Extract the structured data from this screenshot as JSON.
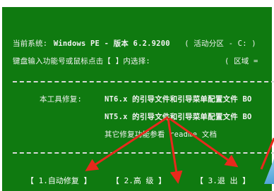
{
  "system_line": {
    "label": "当前系统:",
    "os": "Windows PE - 版本 6.2.9200",
    "partition": "( 活动分区 - C: )"
  },
  "prompt_line": {
    "text": "键盘输入功能号或鼠标点击【 】内选择:",
    "region": "( 区域 ="
  },
  "repair_section": {
    "title": "本工具修复:",
    "nt6": "NT6.x 的引导文件和引导菜单配置文件 BO",
    "nt5": "NT5.x 的引导文件和引导菜单配置文件 BO",
    "other": "其它修复功能参看 readme 文档"
  },
  "menu": {
    "auto_repair": "【 1.自动修复 】",
    "advanced": "【 2.高  级 】",
    "exit": "【 3.退  出 】"
  },
  "colors": {
    "background": "#0f7a10",
    "text": "#f2f2f2",
    "arrow": "#e8291c",
    "corner_accent": "#4aa0d8"
  }
}
